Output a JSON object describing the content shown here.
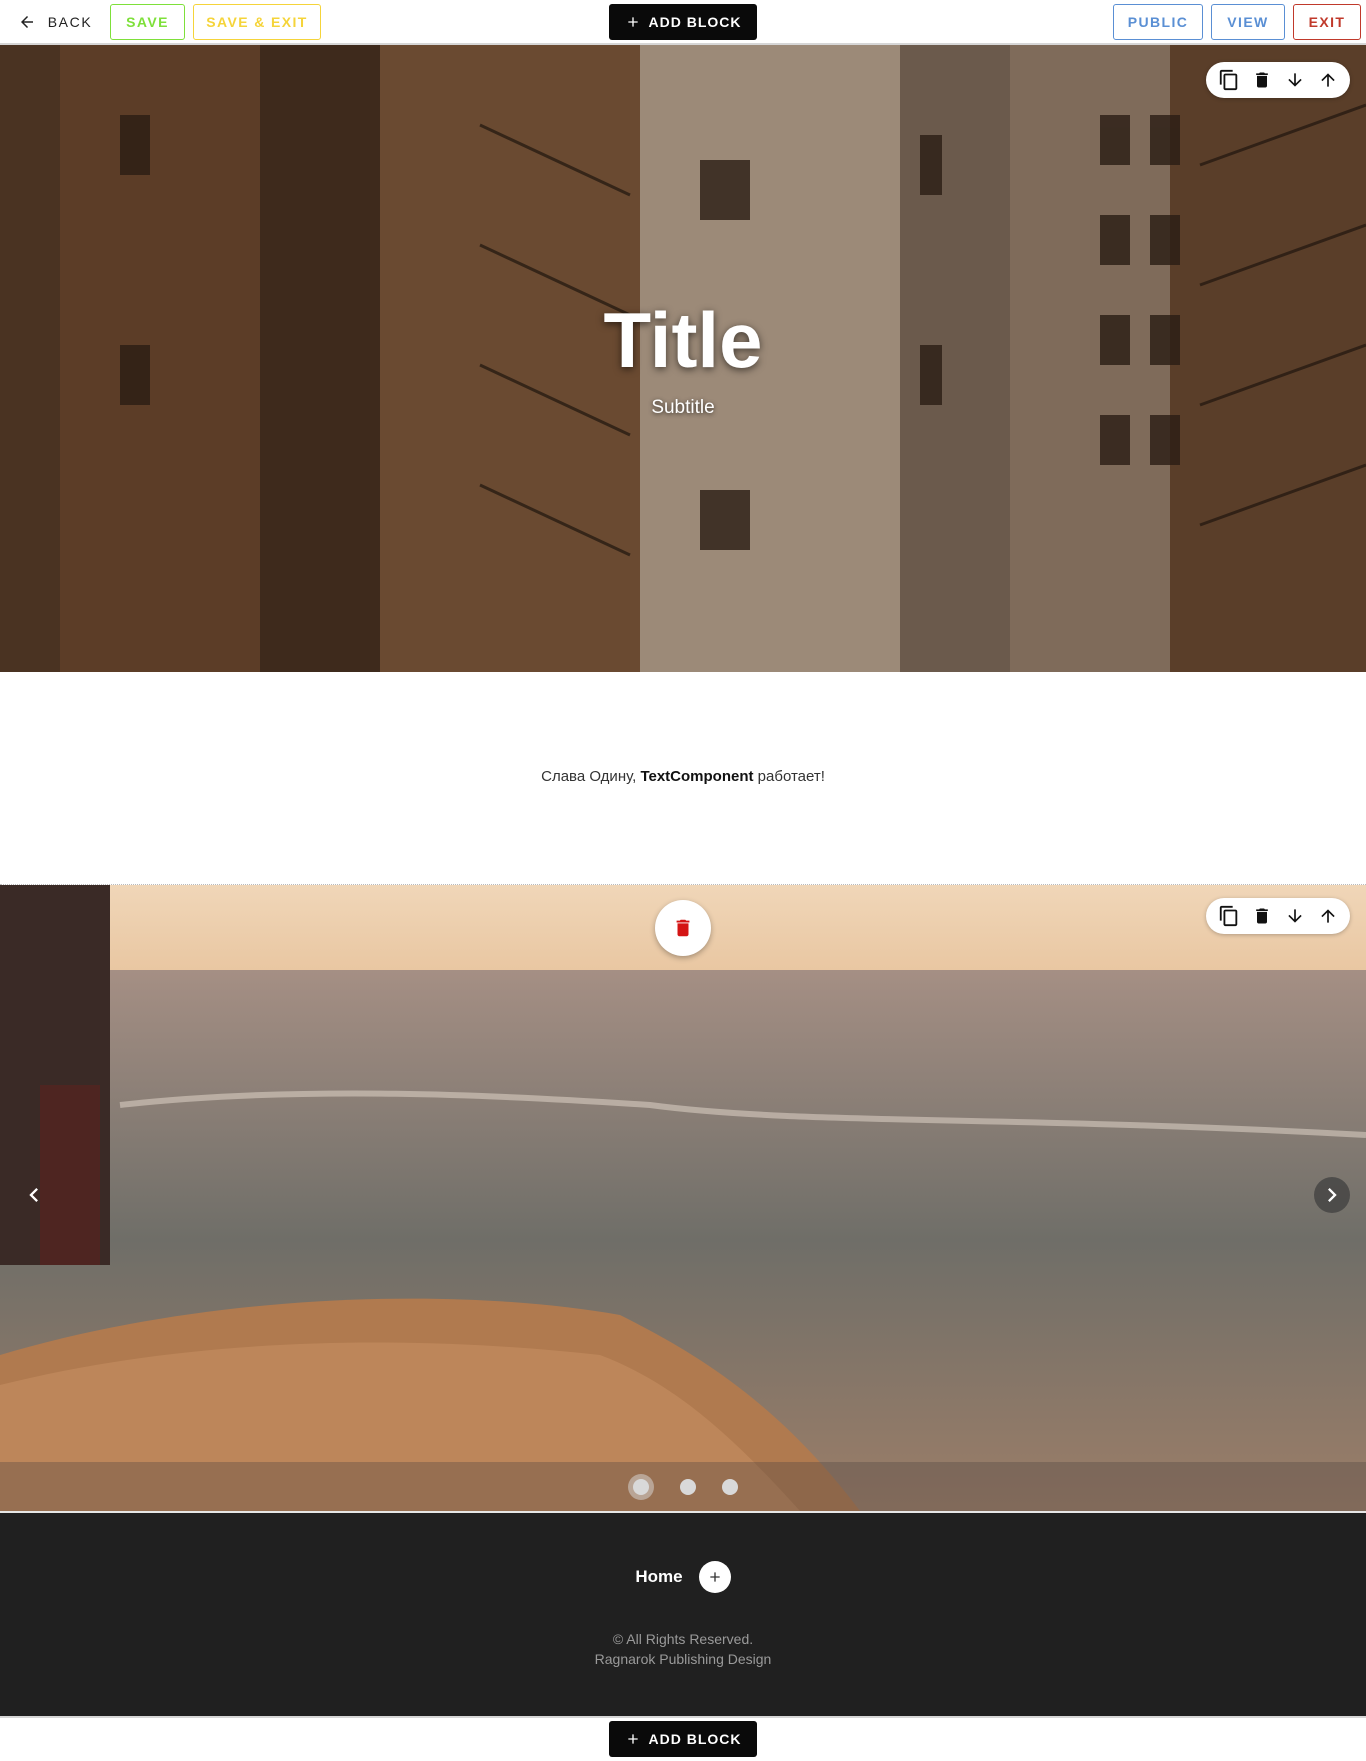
{
  "toolbar": {
    "back_label": "BACK",
    "save_label": "SAVE",
    "save_exit_label": "SAVE & EXIT",
    "add_block_label": "ADD BLOCK",
    "public_label": "PUBLIC",
    "view_label": "VIEW",
    "exit_label": "EXIT"
  },
  "hero": {
    "title": "Title",
    "subtitle": "Subtitle",
    "tools": [
      "copy-icon",
      "trash-icon",
      "arrow-down-icon",
      "arrow-up-icon"
    ]
  },
  "text_block": {
    "prefix": "Слава Одину, ",
    "bold": "TextComponent",
    "suffix": " работает!"
  },
  "slider": {
    "slide_count": 3,
    "active_index": 0,
    "tools": [
      "copy-icon",
      "trash-icon",
      "arrow-down-icon",
      "arrow-up-icon"
    ]
  },
  "footer": {
    "nav_home": "Home",
    "copyright": "© All Rights Reserved.",
    "company": "Ragnarok Publishing Design"
  },
  "bottom": {
    "add_block_label": "ADD BLOCK"
  },
  "colors": {
    "save": "#7ee03a",
    "save_exit": "#f5d43a",
    "public_view": "#5a8fd4",
    "exit": "#c0392b",
    "delete": "#d41414",
    "footer_bg": "#202020"
  }
}
